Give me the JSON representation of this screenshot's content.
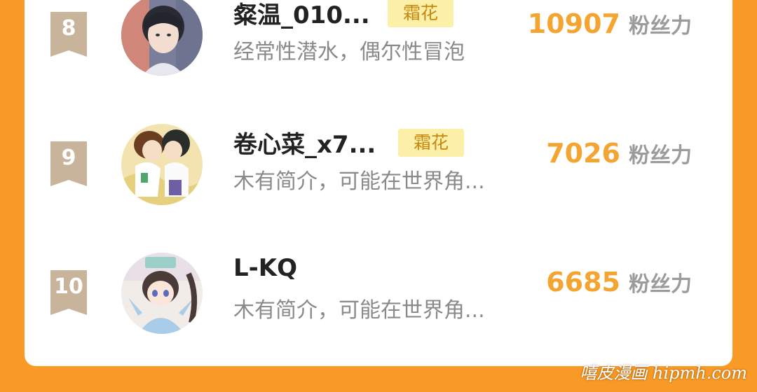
{
  "rows": [
    {
      "rank": "8",
      "name": "粲温_010...",
      "tag": "霜花",
      "bio": "经常性潜水，偶尔性冒泡",
      "score": "10907",
      "score_unit": "粉丝力",
      "avatar": "boy-portrait-avatar"
    },
    {
      "rank": "9",
      "name": "卷心菜_x7...",
      "tag": "霜花",
      "bio": "木有简介，可能在世界角...",
      "score": "7026",
      "score_unit": "粉丝力",
      "avatar": "two-girls-anime-avatar"
    },
    {
      "rank": "10",
      "name": "L-KQ",
      "tag": "",
      "bio": "木有简介，可能在世界角...",
      "score": "6685",
      "score_unit": "粉丝力",
      "avatar": "chibi-girl-avatar"
    }
  ],
  "watermark": "嘻皮漫画 hipmh.com",
  "colors": {
    "background": "#FA9A26",
    "card": "#FFFFFF",
    "score": "#F4A531",
    "badge": "#C8B49A",
    "tag_bg": "#FCEFA8",
    "tag_text": "#C9870E"
  }
}
